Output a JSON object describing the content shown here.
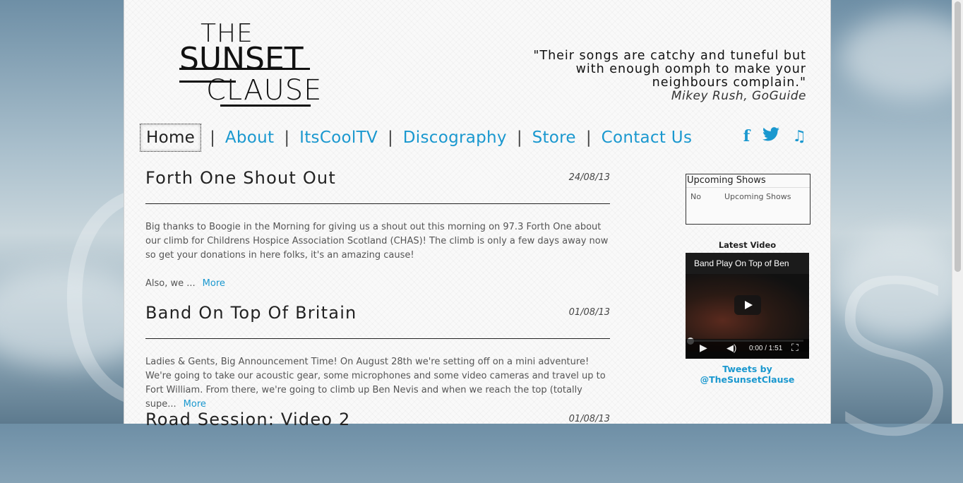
{
  "logo": {
    "line1": "THE",
    "line2": "SUNSET",
    "line3": "CLAUSE"
  },
  "quote": {
    "line1": "\"Their songs are catchy and tuneful but",
    "line2": "with enough oomph to make your",
    "line3": "neighbours complain.\"",
    "attribution": "Mikey Rush, GoGuide"
  },
  "nav": {
    "items": [
      "Home",
      "About",
      "ItsCoolTV",
      "Discography",
      "Store",
      "Contact Us"
    ],
    "separator": "|",
    "active": "Home"
  },
  "social": {
    "facebook": "f",
    "twitter": "t",
    "music": "♫"
  },
  "posts": [
    {
      "title": "Forth One Shout Out",
      "date": "24/08/13",
      "paragraph1": "Big thanks to Boogie in the Morning for giving us a shout out this morning on 97.3 Forth One about our climb for Childrens Hospice Association Scotland (CHAS)! The climb is only a few days away now so get your donations in here folks, it's an amazing cause!",
      "paragraph2": "Also, we ...",
      "more": "More"
    },
    {
      "title": "Band On Top Of Britain",
      "date": "01/08/13",
      "paragraph1": "Ladies & Gents, Big Announcement Time! On August 28th we're setting off on a mini adventure! We're going to take our acoustic gear, some microphones and some video cameras and travel up to Fort William. From there, we're going to climb up Ben Nevis and when we reach the top (totally supe...",
      "more": "More"
    },
    {
      "title": "Road Session: Video 2",
      "date": "01/08/13"
    }
  ],
  "sidebar": {
    "upcoming_title": "Upcoming Shows",
    "upcoming_col1": "No",
    "upcoming_col2": "Upcoming Shows",
    "latest_video_label": "Latest Video",
    "video_title": "Band Play On Top of Ben",
    "video_time": "0:00 / 1:51",
    "tweets_link": "Tweets by @TheSunsetClause"
  },
  "colors": {
    "link": "#1a98cf",
    "text": "#222222"
  }
}
